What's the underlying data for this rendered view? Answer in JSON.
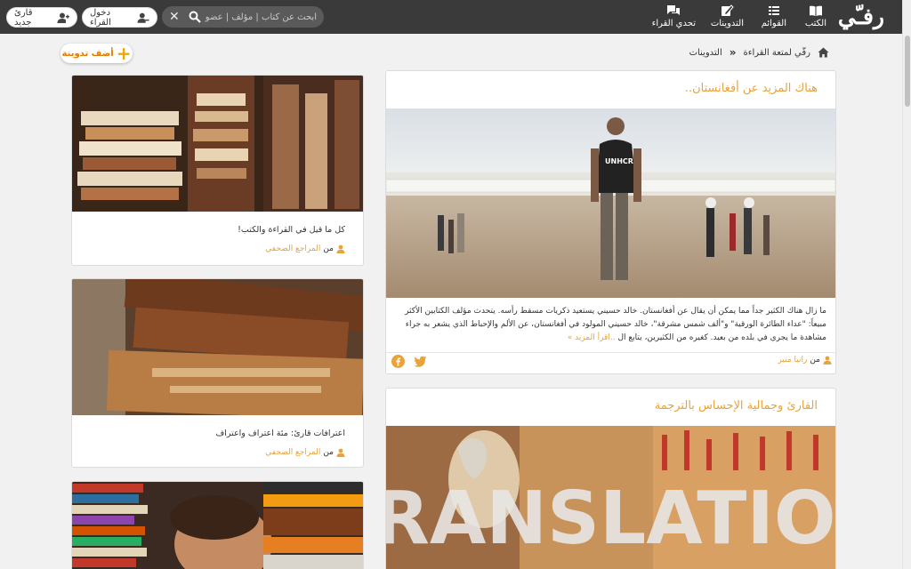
{
  "header": {
    "logo": "رفـّي",
    "nav": {
      "books": "الكتب",
      "lists": "القوائم",
      "blogs": "التدوينات",
      "challenge": "تحدي القراء"
    },
    "search_placeholder": "ابحث عن كتاب | مؤلف | عضو | ناش",
    "login": "دخول القراء",
    "signup": "قارئ جديد"
  },
  "breadcrumb": {
    "home": "رفّي لمتعة القراءة",
    "current": "التدوينات"
  },
  "add_post": "أضف تدوينة",
  "posts": [
    {
      "title": "هناك المزيد عن أفغانستان..",
      "excerpt": "ما زال هناك الكثير جداً مما يمكن أن يقال عن أفغانستان. خالد حسيني يستعيد ذكريات مسقط رأسه. يتحدث مؤلف الكتابين الأكثر مبيعاً: \"عداء الطائرة الورقية\" و\"ألف شمس مشرقة\"، خالد حسيني المولود في أفغانستان، عن الألم والإحباط الذي يشعر به جراء مشاهدة ما يجري في بلده من بعيد. كغيره من الكثيرين، يتابع ال",
      "more": "..اقرأ المزيد »",
      "author_prefix": "من",
      "author": "رانيا منير",
      "image_caption": "UNHCR"
    },
    {
      "title": "القارئ وجمالية الإحساس بالترجمة",
      "image_caption": "TRANSLATION"
    }
  ],
  "side_posts": [
    {
      "title": "كل ما قيل في القراءة والكتب!",
      "author_prefix": "من",
      "author": "المراجع الصحفي"
    },
    {
      "title": "اعترافات قارئ: مئة اعتراف واعتراف",
      "author_prefix": "من",
      "author": "المراجع الصحفي"
    },
    {
      "title": "",
      "author_prefix": "",
      "author": ""
    }
  ],
  "colors": {
    "header_bg": "#3a3a3a",
    "accent": "#e8a33a",
    "add_orange": "#f0a500",
    "page_bg": "#f1f1f1"
  }
}
